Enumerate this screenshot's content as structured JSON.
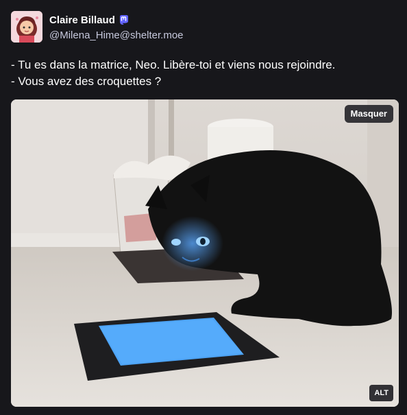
{
  "post": {
    "author": {
      "display_name": "Claire Billaud",
      "handle": "@Milena_Hime@shelter.moe",
      "badge_icon": "mastodon-icon"
    },
    "content": {
      "lines": [
        "- Tu es dans la matrice, Neo. Libère-toi et viens nous rejoindre.",
        "- Vous avez des croquettes ?"
      ]
    },
    "media": {
      "hide_label": "Masquer",
      "alt_label": "ALT",
      "description_icon": "cat-tablet-image"
    }
  },
  "colors": {
    "background": "#17171b",
    "text": "#ffffff",
    "muted": "#c7c9dd",
    "badge": "#6364ff",
    "tablet_screen": "#4da3f5"
  }
}
